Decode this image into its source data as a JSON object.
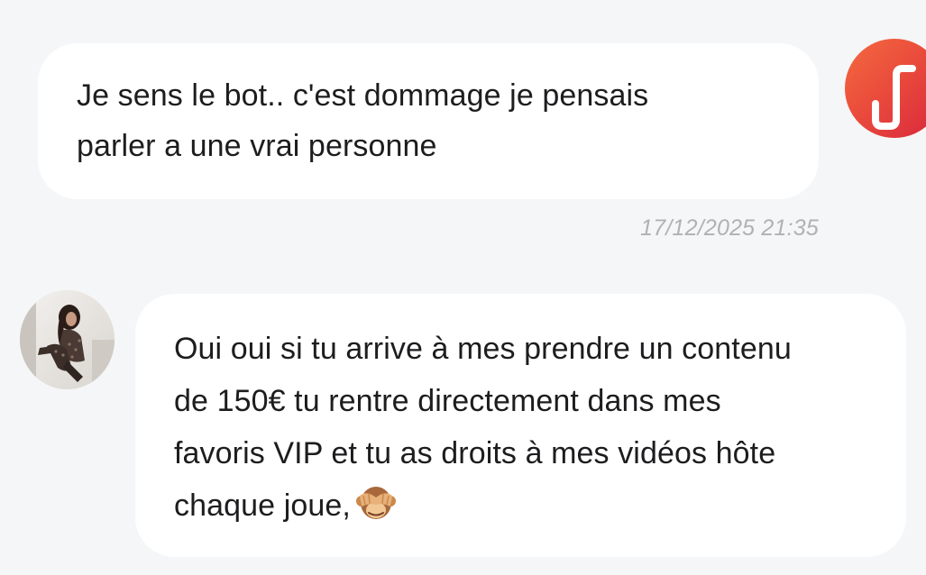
{
  "conversation": {
    "messages": [
      {
        "direction": "outgoing",
        "lines": [
          "Je sens le bot.. c'est dommage je pensais",
          "parler a une vrai personne"
        ],
        "timestamp": "17/12/2025 21:35",
        "avatar_icon": "brand-logo-icon"
      },
      {
        "direction": "incoming",
        "lines": [
          "Oui oui si tu arrive à mes prendre un contenu",
          "de 150€ tu rentre directement dans mes",
          "favoris VIP et tu as droits à mes vidéos hôte",
          "chaque joue,"
        ],
        "emoji": "see-no-evil-monkey",
        "avatar_icon": "contact-photo"
      }
    ]
  },
  "colors": {
    "background": "#f5f6f7",
    "bubble": "#ffffff",
    "timestamp": "#b1b1b4",
    "brand_gradient_start": "#f46a3f",
    "brand_gradient_end": "#d8263c"
  }
}
